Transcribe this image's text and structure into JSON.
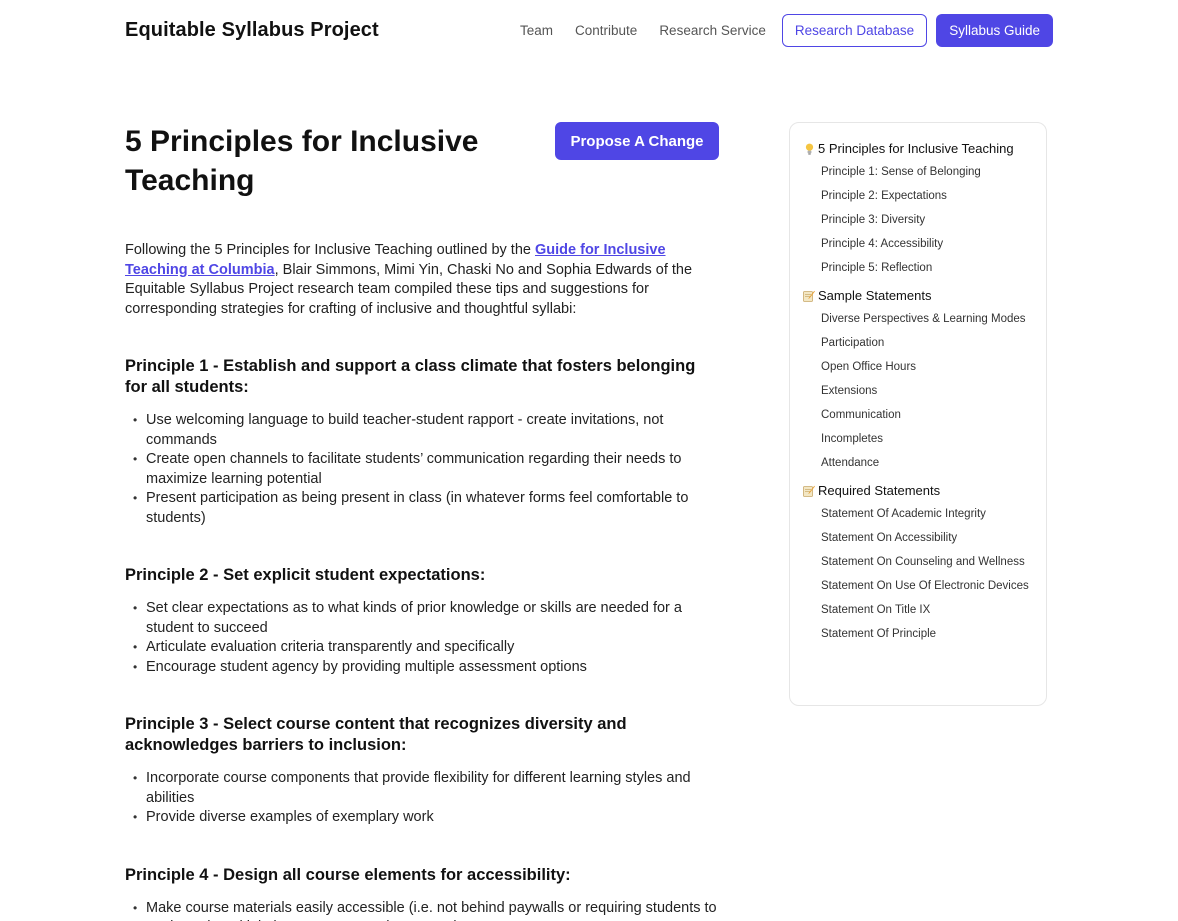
{
  "header": {
    "brand": "Equitable Syllabus Project",
    "nav": [
      "Team",
      "Contribute",
      "Research Service"
    ],
    "research_database": "Research Database",
    "syllabus_guide": "Syllabus Guide"
  },
  "main": {
    "title": "5 Principles for Inclusive Teaching",
    "propose_button": "Propose A Change",
    "intro_before": "Following the 5 Principles for Inclusive Teaching outlined by the ",
    "intro_link": "Guide for Inclusive Teaching at Columbia",
    "intro_after": ", Blair Simmons, Mimi Yin, Chaski No and Sophia Edwards of the Equitable Syllabus Project research team compiled these tips and suggestions for corresponding strategies for crafting of inclusive and thoughtful syllabi:",
    "sections": [
      {
        "heading": "Principle 1 - Establish and support a class climate that fosters belonging for all students:",
        "items": [
          "Use welcoming language to build teacher-student rapport -  create invitations, not commands",
          "Create open channels to facilitate students’ communication regarding their needs to maximize learning potential",
          "Present participation as being present in class (in whatever forms feel comfortable to students)"
        ]
      },
      {
        "heading": "Principle 2 - Set explicit student expectations:",
        "items": [
          "Set clear expectations as to what kinds of prior knowledge or skills are needed for a student to succeed",
          "Articulate evaluation criteria transparently and specifically",
          "Encourage student agency by providing multiple assessment options"
        ]
      },
      {
        "heading": "Principle 3 - Select course content that recognizes diversity and acknowledges barriers to inclusion:",
        "items": [
          "Incorporate course components that provide flexibility for different learning styles and abilities",
          "Provide diverse examples of exemplary work"
        ]
      },
      {
        "heading": "Principle 4 - Design all course elements for accessibility:",
        "items": [
          "Make course materials easily accessible (i.e. not behind paywalls or requiring students to go through multiple hoops to access the content)"
        ]
      }
    ]
  },
  "sidebar": {
    "groups": [
      {
        "icon": "lightbulb-icon",
        "heading": "5 Principles for Inclusive Teaching",
        "items": [
          "Principle 1: Sense of Belonging",
          "Principle 2: Expectations",
          "Principle 3: Diversity",
          "Principle 4: Accessibility",
          "Principle 5: Reflection"
        ]
      },
      {
        "icon": "memo-icon",
        "heading": "Sample Statements",
        "items": [
          "Diverse Perspectives & Learning Modes",
          "Participation",
          "Open Office Hours",
          "Extensions",
          "Communication",
          "Incompletes",
          "Attendance"
        ]
      },
      {
        "icon": "memo-icon",
        "heading": "Required Statements",
        "items": [
          "Statement Of Academic Integrity",
          "Statement On Accessibility",
          "Statement On Counseling and Wellness",
          "Statement On Use Of Electronic Devices",
          "Statement On Title IX",
          "Statement Of Principle"
        ]
      }
    ]
  },
  "colors": {
    "accent": "#4f46e5"
  }
}
